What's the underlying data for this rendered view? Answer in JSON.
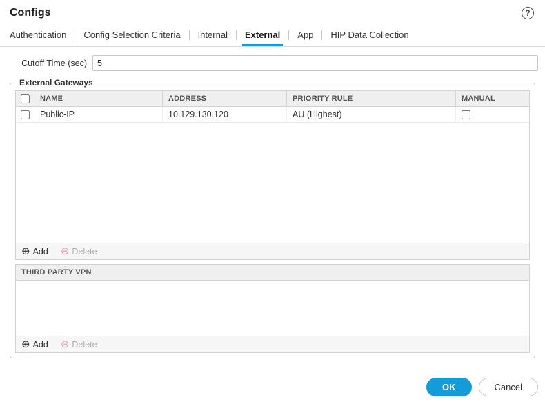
{
  "window": {
    "title": "Configs"
  },
  "icons": {
    "help": "?",
    "add": "⊕",
    "delete": "⊖"
  },
  "tabs": [
    {
      "label": "Authentication",
      "active": false
    },
    {
      "label": "Config Selection Criteria",
      "active": false
    },
    {
      "label": "Internal",
      "active": false
    },
    {
      "label": "External",
      "active": true
    },
    {
      "label": "App",
      "active": false
    },
    {
      "label": "HIP Data Collection",
      "active": false
    }
  ],
  "cutoff": {
    "label": "Cutoff Time (sec)",
    "value": "5"
  },
  "external_gateways": {
    "legend": "External Gateways",
    "gateway_table": {
      "columns": [
        "NAME",
        "ADDRESS",
        "PRIORITY RULE",
        "MANUAL"
      ],
      "rows": [
        {
          "name": "Public-IP",
          "address": "10.129.130.120",
          "priority_rule": "AU (Highest)",
          "selected": false,
          "manual_checked": false
        }
      ],
      "add_label": "Add",
      "delete_label": "Delete",
      "delete_enabled": false
    },
    "third_party_table": {
      "header": "THIRD PARTY VPN",
      "rows": [],
      "add_label": "Add",
      "delete_label": "Delete",
      "delete_enabled": false
    }
  },
  "dialog_footer": {
    "ok_label": "OK",
    "cancel_label": "Cancel"
  },
  "colors": {
    "accent_blue": "#149cd8",
    "ok_button_bg": "#149cd8",
    "table_header_bg": "#efefef",
    "action_bar_bg": "#f6f6f6",
    "delete_icon_pink": "#e7a0ab"
  }
}
